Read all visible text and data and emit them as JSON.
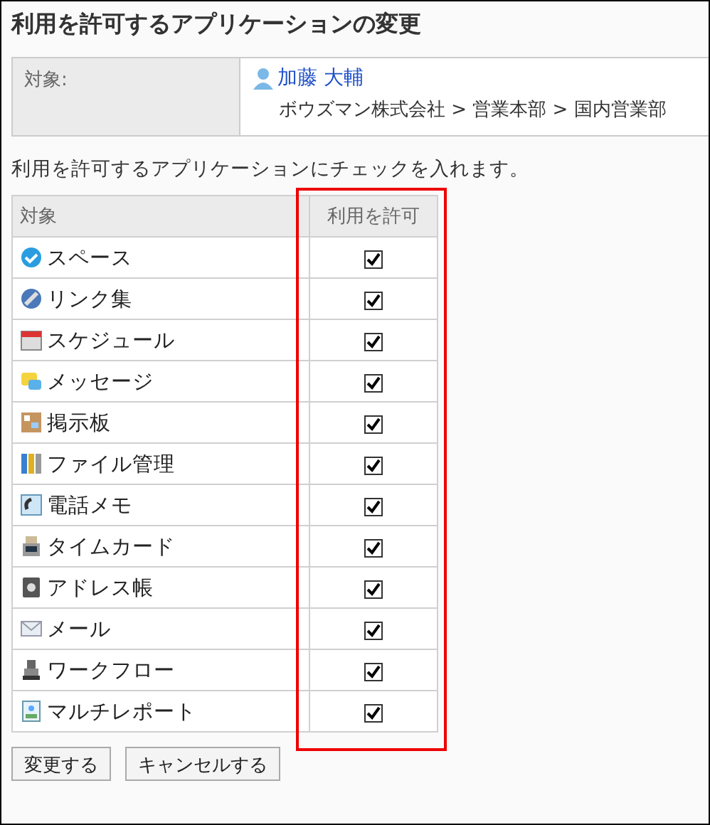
{
  "title": "利用を許可するアプリケーションの変更",
  "target": {
    "label": "対象:",
    "user": "加藤 大輔",
    "path": "ボウズマン株式会社 > 営業本部 > 国内営業部"
  },
  "instruction": "利用を許可するアプリケーションにチェックを入れます。",
  "table": {
    "columns": [
      "対象",
      "利用を許可"
    ],
    "rows": [
      {
        "name": "スペース",
        "checked": true
      },
      {
        "name": "リンク集",
        "checked": true
      },
      {
        "name": "スケジュール",
        "checked": true
      },
      {
        "name": "メッセージ",
        "checked": true
      },
      {
        "name": "掲示板",
        "checked": true
      },
      {
        "name": "ファイル管理",
        "checked": true
      },
      {
        "name": "電話メモ",
        "checked": true
      },
      {
        "name": "タイムカード",
        "checked": true
      },
      {
        "name": "アドレス帳",
        "checked": true
      },
      {
        "name": "メール",
        "checked": true
      },
      {
        "name": "ワークフロー",
        "checked": true
      },
      {
        "name": "マルチレポート",
        "checked": true
      }
    ]
  },
  "buttons": [
    "変更する",
    "キャンセルする"
  ]
}
